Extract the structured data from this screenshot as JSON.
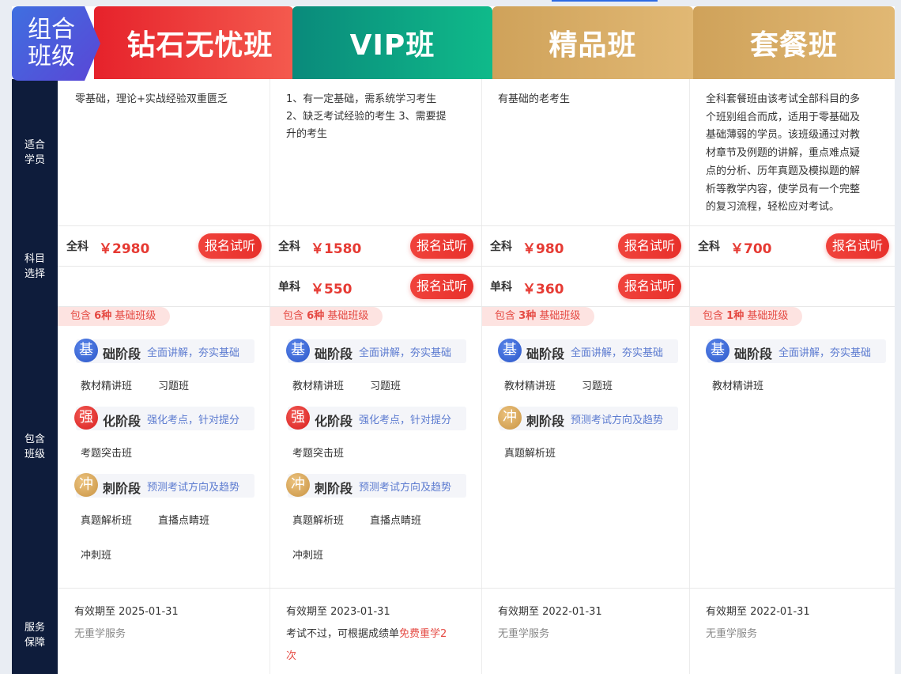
{
  "badge": {
    "line1": "组合",
    "line2": "班级"
  },
  "columns": [
    {
      "name": "钻石无忧班",
      "students": [
        "零基础，理论+实战经验双重匮乏"
      ],
      "prices": [
        {
          "label": "全科",
          "price": "￥2980",
          "btn": "报名试听"
        }
      ],
      "tag_pre": "包含",
      "tag_num": "6种",
      "tag_post": "基础班级",
      "stages": [
        {
          "icon": "基",
          "name": "础阶段",
          "desc": "全面讲解，夯实基础",
          "classes": [
            "教材精讲班",
            "习题班"
          ]
        },
        {
          "icon": "强",
          "name": "化阶段",
          "desc": "强化考点，针对提分",
          "classes": [
            "考题突击班"
          ]
        },
        {
          "icon": "冲",
          "name": "刺阶段",
          "desc": "预测考试方向及趋势",
          "classes": [
            "真题解析班",
            "直播点睛班",
            "冲刺班"
          ]
        }
      ],
      "validity": "有效期至 2025-01-31",
      "service": "无重学服务"
    },
    {
      "name": "VIP班",
      "students": [
        "1、有一定基础，需系统学习考生",
        "2、缺乏考试经验的考生 3、需要提",
        "升的考生"
      ],
      "prices": [
        {
          "label": "全科",
          "price": "￥1580",
          "btn": "报名试听"
        },
        {
          "label": "单科",
          "price": "￥550",
          "btn": "报名试听"
        }
      ],
      "tag_pre": "包含",
      "tag_num": "6种",
      "tag_post": "基础班级",
      "stages": [
        {
          "icon": "基",
          "name": "础阶段",
          "desc": "全面讲解，夯实基础",
          "classes": [
            "教材精讲班",
            "习题班"
          ]
        },
        {
          "icon": "强",
          "name": "化阶段",
          "desc": "强化考点，针对提分",
          "classes": [
            "考题突击班"
          ]
        },
        {
          "icon": "冲",
          "name": "刺阶段",
          "desc": "预测考试方向及趋势",
          "classes": [
            "真题解析班",
            "直播点睛班",
            "冲刺班"
          ]
        }
      ],
      "validity": "有效期至 2023-01-31",
      "service_pre": "考试不过，可根据成绩单",
      "service_red1": "免费重学2",
      "service_red2": "次"
    },
    {
      "name": "精品班",
      "students": [
        "有基础的老考生"
      ],
      "prices": [
        {
          "label": "全科",
          "price": "￥980",
          "btn": "报名试听"
        },
        {
          "label": "单科",
          "price": "￥360",
          "btn": "报名试听"
        }
      ],
      "tag_pre": "包含",
      "tag_num": "3种",
      "tag_post": "基础班级",
      "stages": [
        {
          "icon": "基",
          "name": "础阶段",
          "desc": "全面讲解，夯实基础",
          "classes": [
            "教材精讲班",
            "习题班"
          ]
        },
        {
          "icon": "冲",
          "name": "刺阶段",
          "desc": "预测考试方向及趋势",
          "classes": [
            "真题解析班"
          ]
        }
      ],
      "validity": "有效期至 2022-01-31",
      "service": "无重学服务"
    },
    {
      "name": "套餐班",
      "students": [
        "全科套餐班由该考试全部科目的多",
        "个班别组合而成，适用于零基础及",
        "基础薄弱的学员。该班级通过对教",
        "材章节及例题的讲解，重点难点疑",
        "点的分析、历年真题及模拟题的解",
        "析等教学内容，使学员有一个完整",
        "的复习流程，轻松应对考试。"
      ],
      "prices": [
        {
          "label": "全科",
          "price": "￥700",
          "btn": "报名试听"
        }
      ],
      "tag_pre": "包含",
      "tag_num": "1种",
      "tag_post": "基础班级",
      "stages": [
        {
          "icon": "基",
          "name": "础阶段",
          "desc": "全面讲解，夯实基础",
          "classes": [
            "教材精讲班"
          ]
        }
      ],
      "validity": "有效期至 2022-01-31",
      "service": "无重学服务"
    }
  ],
  "rows": {
    "students": [
      "适合",
      "学员"
    ],
    "subjects": [
      "科目",
      "选择"
    ],
    "classes": [
      "包含",
      "班级"
    ],
    "service": [
      "服务",
      "保障"
    ]
  },
  "colors": {
    "red": "#e63a33",
    "navy": "#0e1c3b",
    "teal": "#0fba8a",
    "gold": "#d8ab64",
    "blue": "#3f6fe0"
  }
}
